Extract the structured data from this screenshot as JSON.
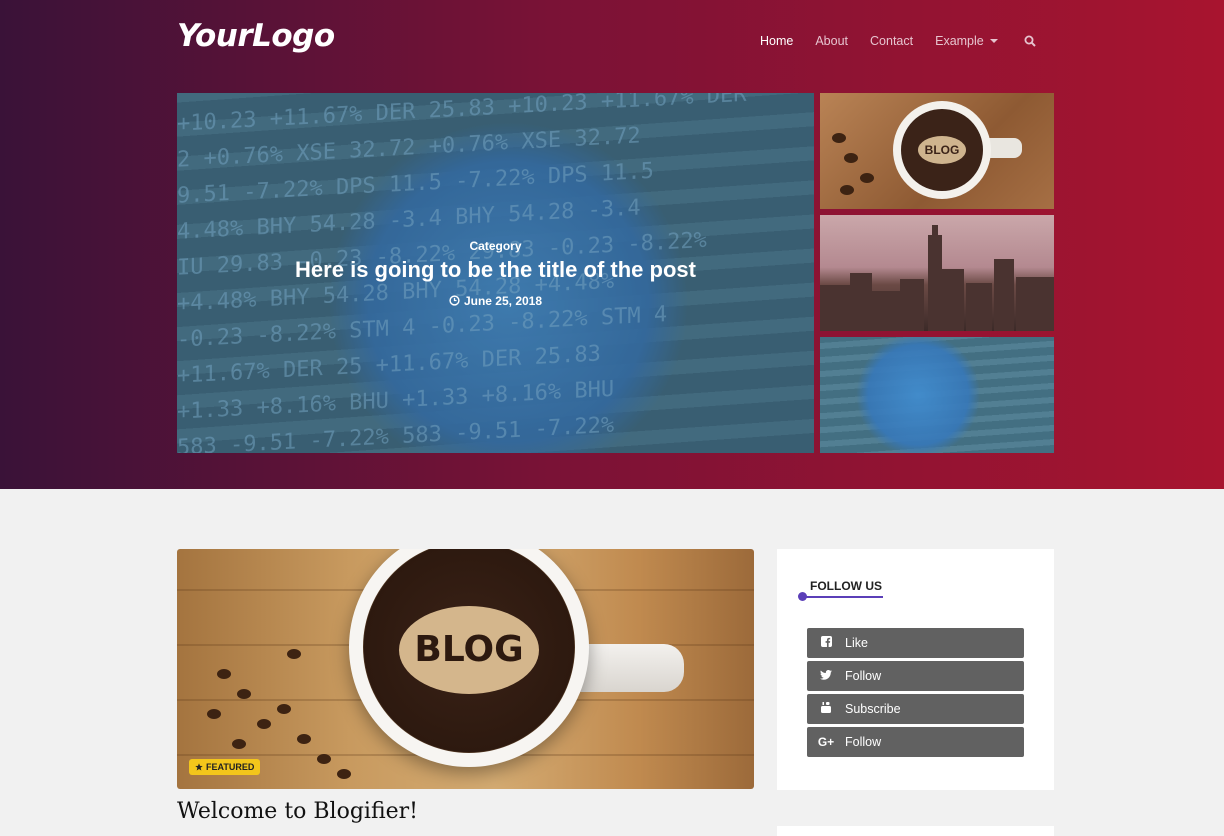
{
  "header": {
    "logo": "YourLogo",
    "nav": [
      {
        "label": "Home",
        "active": true
      },
      {
        "label": "About",
        "active": false
      },
      {
        "label": "Contact",
        "active": false
      },
      {
        "label": "Example",
        "active": false,
        "dropdown": true
      }
    ],
    "search_icon": "search-icon"
  },
  "hero": {
    "main": {
      "category": "Category",
      "title": "Here is going to be the title of the post",
      "date": "June 25, 2018",
      "date_icon": "clock-icon"
    },
    "ticker_lines": [
      "+10.23 +11.67% DER 25.83 +10.23 +11.67% DER",
      "2 +0.76% XSE 32.72 +0.76% XSE 32.72",
      "9.51 -7.22% DPS 11.5 -7.22% DPS 11.5",
      "4.48% BHY 54.28 -3.4 BHY 54.28 -3.4",
      "IU 29.83 -0.23 -8.22% 29.83 -0.23 -8.22%",
      "+4.48% BHY 54.28 BHY 54.28 +4.48%",
      "-0.23 -8.22% STM 4 -0.23 -8.22% STM 4",
      "+11.67% DER 25 +11.67% DER 25.83",
      "+1.33 +8.16% BHU +1.33 +8.16% BHU",
      "583 -9.51 -7.22% 583 -9.51 -7.22%"
    ],
    "thumb_blog_text": "BLOG"
  },
  "post": {
    "badge": "FEATURED",
    "badge_icon": "star-icon",
    "image_text": "BLOG",
    "title": "Welcome to Blogifier!"
  },
  "sidebar": {
    "follow_title": "FOLLOW US",
    "accent": "#5b3fb8",
    "buttons": [
      {
        "icon": "facebook-icon",
        "label": "Like"
      },
      {
        "icon": "twitter-icon",
        "label": "Follow"
      },
      {
        "icon": "youtube-icon",
        "label": "Subscribe"
      },
      {
        "icon": "google-plus-icon",
        "label": "Follow"
      }
    ]
  }
}
